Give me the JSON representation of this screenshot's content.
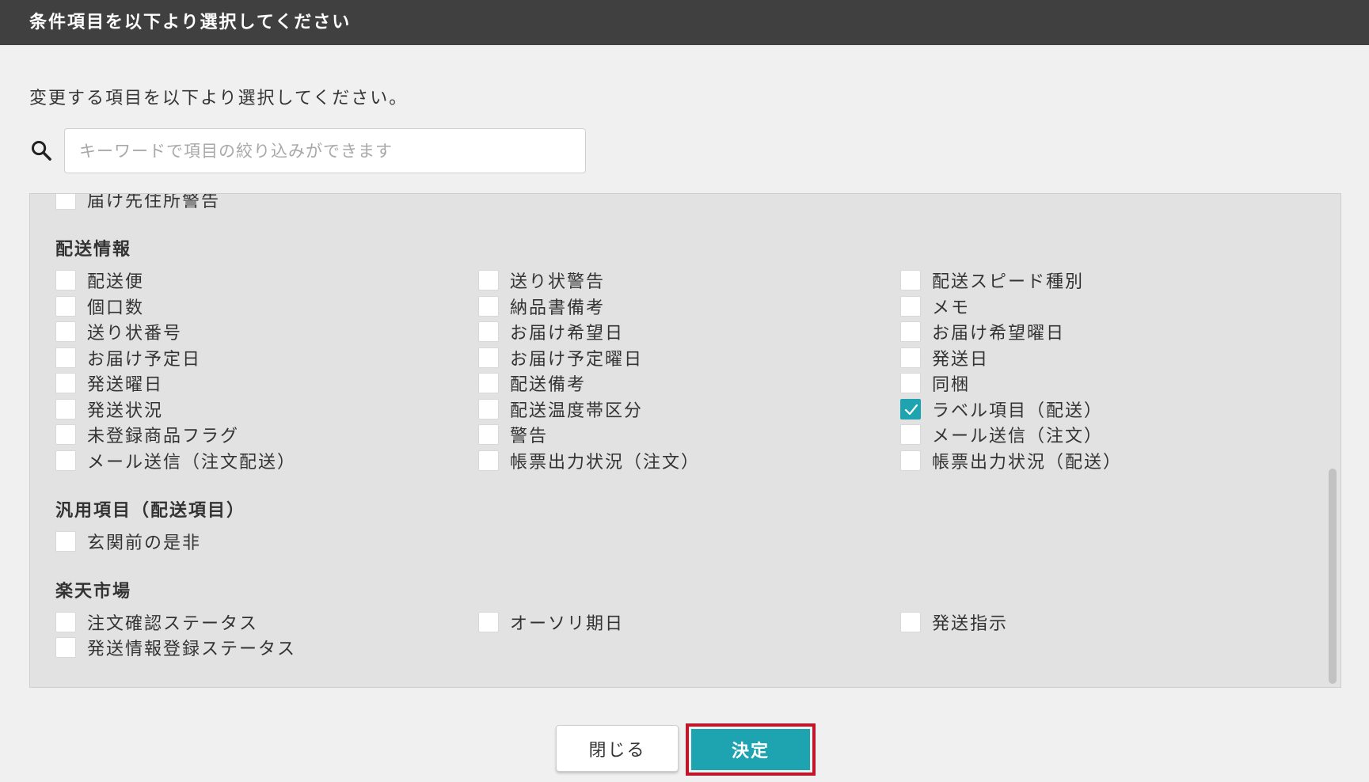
{
  "dialog": {
    "title": "条件項目を以下より選択してください",
    "instruction": "変更する項目を以下より選択してください。"
  },
  "search": {
    "placeholder": "キーワードで項目の絞り込みができます",
    "value": "",
    "icon": "search-icon"
  },
  "partial_item": {
    "label": "届け先住所警告",
    "checked": false
  },
  "sections": [
    {
      "title": "配送情報",
      "items": [
        {
          "label": "配送便",
          "checked": false
        },
        {
          "label": "送り状警告",
          "checked": false
        },
        {
          "label": "配送スピード種別",
          "checked": false
        },
        {
          "label": "個口数",
          "checked": false
        },
        {
          "label": "納品書備考",
          "checked": false
        },
        {
          "label": "メモ",
          "checked": false
        },
        {
          "label": "送り状番号",
          "checked": false
        },
        {
          "label": "お届け希望日",
          "checked": false
        },
        {
          "label": "お届け希望曜日",
          "checked": false
        },
        {
          "label": "お届け予定日",
          "checked": false
        },
        {
          "label": "お届け予定曜日",
          "checked": false
        },
        {
          "label": "発送日",
          "checked": false
        },
        {
          "label": "発送曜日",
          "checked": false
        },
        {
          "label": "配送備考",
          "checked": false
        },
        {
          "label": "同梱",
          "checked": false
        },
        {
          "label": "発送状況",
          "checked": false
        },
        {
          "label": "配送温度帯区分",
          "checked": false
        },
        {
          "label": "ラベル項目（配送）",
          "checked": true
        },
        {
          "label": "未登録商品フラグ",
          "checked": false
        },
        {
          "label": "警告",
          "checked": false
        },
        {
          "label": "メール送信（注文）",
          "checked": false
        },
        {
          "label": "メール送信（注文配送）",
          "checked": false
        },
        {
          "label": "帳票出力状況（注文）",
          "checked": false
        },
        {
          "label": "帳票出力状況（配送）",
          "checked": false
        }
      ]
    },
    {
      "title": "汎用項目（配送項目）",
      "items": [
        {
          "label": "玄関前の是非",
          "checked": false
        }
      ]
    },
    {
      "title": "楽天市場",
      "items": [
        {
          "label": "注文確認ステータス",
          "checked": false
        },
        {
          "label": "オーソリ期日",
          "checked": false
        },
        {
          "label": "発送指示",
          "checked": false
        },
        {
          "label": "発送情報登録ステータス",
          "checked": false
        }
      ]
    }
  ],
  "buttons": {
    "close": "閉じる",
    "confirm": "決定"
  },
  "colors": {
    "titlebar": "#404040",
    "accent": "#1ea3b0",
    "highlight_border": "#c0172b",
    "panel": "#e2e2e2"
  }
}
